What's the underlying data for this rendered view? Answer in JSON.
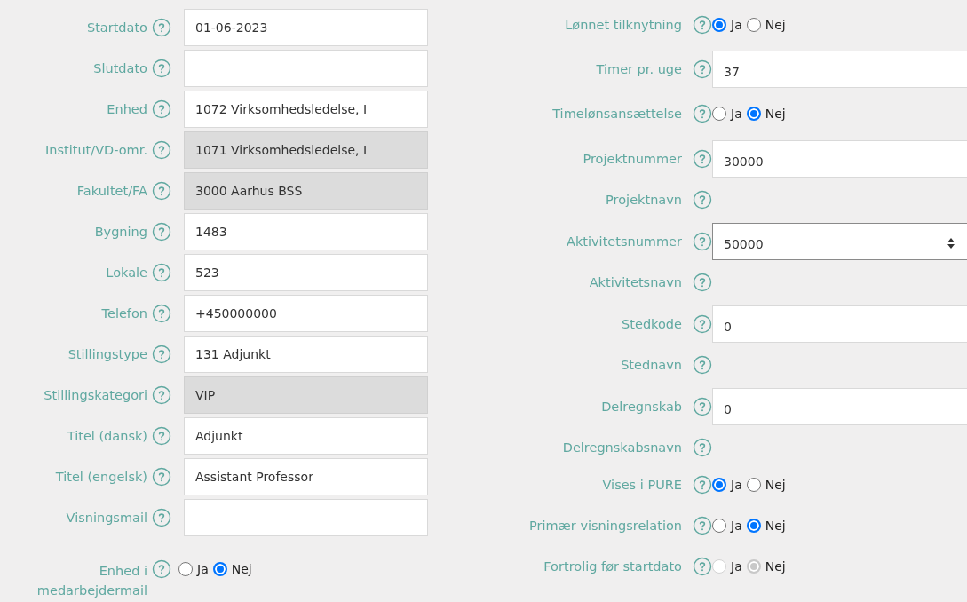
{
  "left_fields": [
    {
      "kind": "input",
      "label": "Startdato",
      "value": "01-06-2023",
      "disabled": false
    },
    {
      "kind": "input",
      "label": "Slutdato",
      "disabled": false
    },
    {
      "kind": "input",
      "label": "Enhed",
      "value": "1072 Virksomhedsledelse, I",
      "disabled": false
    },
    {
      "kind": "input",
      "label": "Institut/VD-omr.",
      "value": "1071 Virksomhedsledelse, I",
      "disabled": true
    },
    {
      "kind": "input",
      "label": "Fakultet/FA",
      "value": "3000 Aarhus BSS",
      "disabled": true
    },
    {
      "kind": "input",
      "label": "Bygning",
      "value": "1483",
      "disabled": false
    },
    {
      "kind": "input",
      "label": "Lokale",
      "value": "523",
      "disabled": false
    },
    {
      "kind": "input",
      "label": "Telefon",
      "value": "+450000000",
      "disabled": false
    },
    {
      "kind": "input",
      "label": "Stillingstype",
      "value": "131 Adjunkt",
      "disabled": false
    },
    {
      "kind": "input",
      "label": "Stillingskategori",
      "value": "VIP",
      "disabled": true
    },
    {
      "kind": "input",
      "label": "Titel (dansk)",
      "value": "Adjunkt",
      "disabled": false
    },
    {
      "kind": "input",
      "label": "Titel (engelsk)",
      "value": "Assistant Professor",
      "disabled": false
    },
    {
      "kind": "input",
      "label": "Visningsmail",
      "disabled": false
    },
    {
      "kind": "radio",
      "label": "Enhed i medarbejdermail",
      "disabled": false,
      "options": [
        {
          "label": "Ja",
          "selected": false
        },
        {
          "label": "Nej",
          "selected": true
        }
      ]
    }
  ],
  "right_fields": [
    {
      "kind": "radio",
      "label": "Lønnet tilknytning",
      "disabled": false,
      "options": [
        {
          "label": "Ja",
          "selected": true
        },
        {
          "label": "Nej",
          "selected": false
        }
      ]
    },
    {
      "kind": "input",
      "label": "Timer pr. uge",
      "value": "37",
      "disabled": false
    },
    {
      "kind": "radio",
      "label": "Timelønsansættelse",
      "disabled": false,
      "options": [
        {
          "label": "Ja",
          "selected": false
        },
        {
          "label": "Nej",
          "selected": true
        }
      ]
    },
    {
      "kind": "input",
      "label": "Projektnummer",
      "value": "30000",
      "disabled": false
    },
    {
      "kind": "text",
      "label": "Projektnavn"
    },
    {
      "kind": "input",
      "label": "Aktivitetsnummer",
      "value": "50000",
      "disabled": false,
      "focused": true,
      "spinner": true
    },
    {
      "kind": "text",
      "label": "Aktivitetsnavn"
    },
    {
      "kind": "input",
      "label": "Stedkode",
      "value": "0",
      "disabled": false
    },
    {
      "kind": "text",
      "label": "Stednavn"
    },
    {
      "kind": "input",
      "label": "Delregnskab",
      "value": "0",
      "disabled": false
    },
    {
      "kind": "text",
      "label": "Delregnskabsnavn"
    },
    {
      "kind": "radio",
      "label": "Vises i PURE",
      "disabled": false,
      "options": [
        {
          "label": "Ja",
          "selected": true
        },
        {
          "label": "Nej",
          "selected": false
        }
      ]
    },
    {
      "kind": "radio",
      "label": "Primær visningsrelation",
      "disabled": false,
      "options": [
        {
          "label": "Ja",
          "selected": false
        },
        {
          "label": "Nej",
          "selected": true
        }
      ]
    },
    {
      "kind": "radio",
      "label": "Fortrolig før startdato",
      "disabled": true,
      "options": [
        {
          "label": "Ja",
          "selected": false
        },
        {
          "label": "Nej",
          "selected": true
        }
      ]
    }
  ]
}
